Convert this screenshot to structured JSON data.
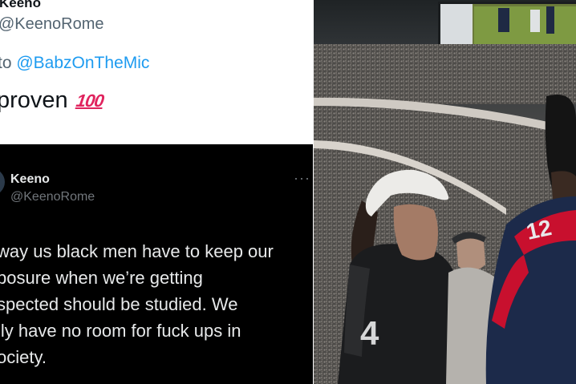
{
  "top_tweet": {
    "display_name": "Keeno",
    "handle": "@KeenoRome",
    "reply_prefix": "to",
    "reply_to": "@BabzOnTheMic",
    "text": "proven",
    "emoji": "100"
  },
  "bottom_tweet": {
    "display_name": "Keeno",
    "handle": "@KeenoRome",
    "menu": "···",
    "text": "way us black men have to keep our\nposure when we’re getting\nspected should be studied. We\nlly have no room for fuck ups in\nociety."
  },
  "photo": {
    "jersey_left_number": "4",
    "jersey_right_number": "12"
  }
}
